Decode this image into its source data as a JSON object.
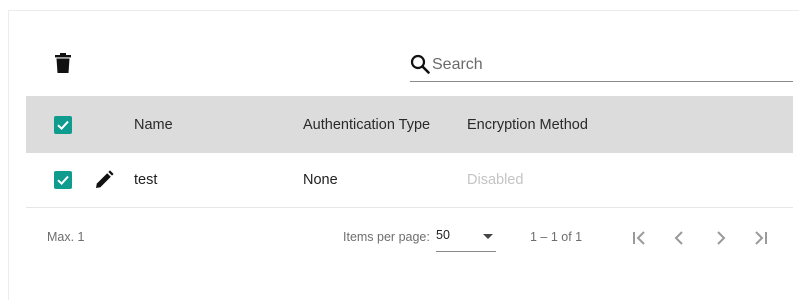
{
  "toolbar": {
    "delete_icon": "trash-icon",
    "search": {
      "placeholder": "Search",
      "value": "",
      "icon": "search-icon"
    }
  },
  "table": {
    "columns": [
      "Name",
      "Authentication Type",
      "Encryption Method"
    ],
    "header_checkbox_checked": true,
    "rows": [
      {
        "checked": true,
        "edit_icon": "pencil-icon",
        "name": "test",
        "authentication_type": "None",
        "encryption_method": "Disabled"
      }
    ]
  },
  "footer": {
    "max_label": "Max. 1",
    "items_per_page_label": "Items per page:",
    "items_per_page_value": "50",
    "range_label": "1 – 1 of 1"
  },
  "colors": {
    "accent": "#0f9b8e",
    "header_bg": "#dcdcdc",
    "disabled_text": "#c4c4c4"
  }
}
